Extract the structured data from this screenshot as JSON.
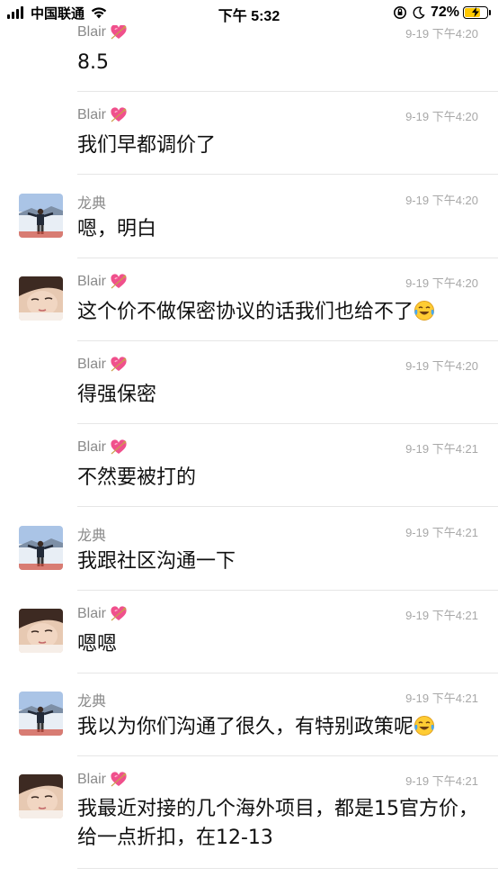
{
  "status_bar": {
    "carrier": "中国联通",
    "time": "下午 5:32",
    "battery": "72%",
    "battery_level": 0.72
  },
  "messages": [
    {
      "sender": "Blair",
      "time": "9-19 下午4:20",
      "text": "8.5",
      "avatar": "none",
      "heart": true
    },
    {
      "sender": "Blair",
      "time": "9-19 下午4:20",
      "text": "我们早都调价了",
      "avatar": "none",
      "heart": true
    },
    {
      "sender": "龙典",
      "time": "9-19 下午4:20",
      "text": "嗯，明白",
      "avatar": "man-snow",
      "heart": false
    },
    {
      "sender": "Blair",
      "time": "9-19 下午4:20",
      "text": "这个价不做保密协议的话我们也给不了",
      "avatar": "woman",
      "heart": true,
      "emoji": "laugh-cry-icon"
    },
    {
      "sender": "Blair",
      "time": "9-19 下午4:20",
      "text": "得强保密",
      "avatar": "none",
      "heart": true
    },
    {
      "sender": "Blair",
      "time": "9-19 下午4:21",
      "text": "不然要被打的",
      "avatar": "none",
      "heart": true
    },
    {
      "sender": "龙典",
      "time": "9-19 下午4:21",
      "text": "我跟社区沟通一下",
      "avatar": "man-snow",
      "heart": false
    },
    {
      "sender": "Blair",
      "time": "9-19 下午4:21",
      "text": "嗯嗯",
      "avatar": "woman",
      "heart": true
    },
    {
      "sender": "龙典",
      "time": "9-19 下午4:21",
      "text": "我以为你们沟通了很久，有特别政策呢",
      "avatar": "man-snow",
      "heart": false,
      "emoji": "laugh-cry-icon"
    },
    {
      "sender": "Blair",
      "time": "9-19 下午4:21",
      "text": "我最近对接的几个海外项目，都是15官方价，给一点折扣，在12-13",
      "avatar": "woman",
      "heart": true
    }
  ]
}
